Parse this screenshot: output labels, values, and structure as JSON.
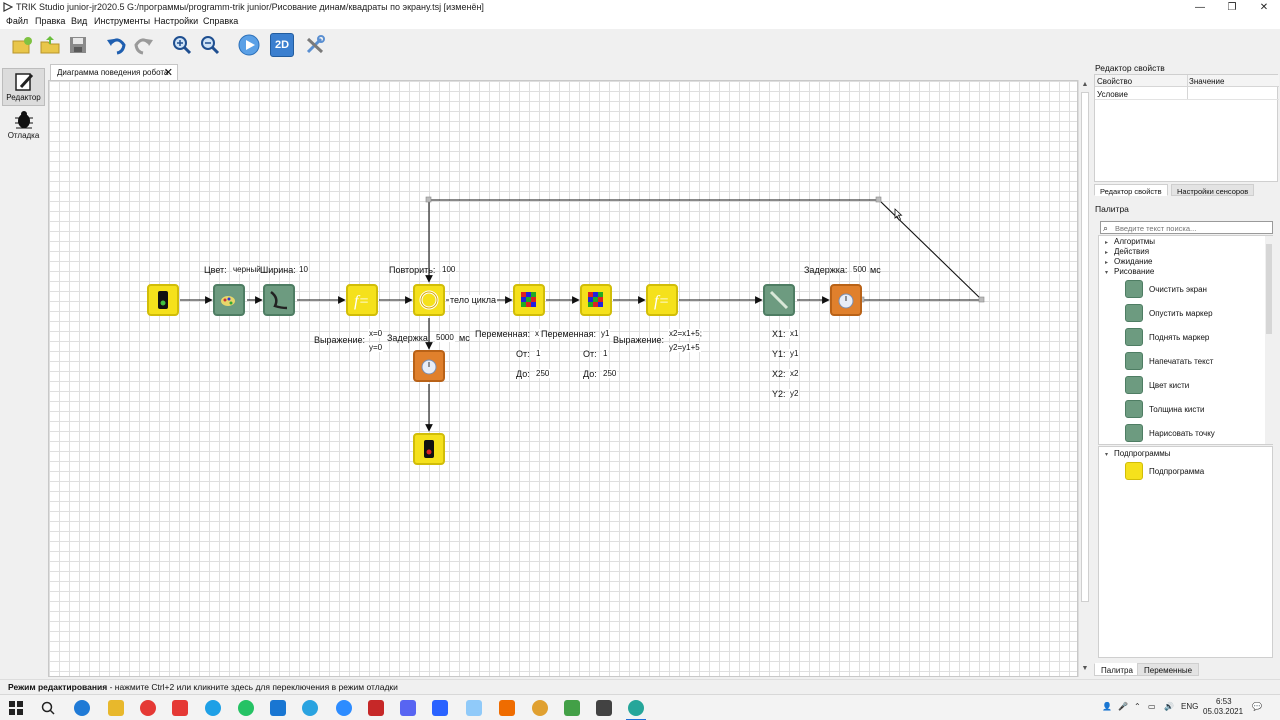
{
  "window": {
    "title": "TRIK Studio junior-jr2020.5 G:/программы/programm-trik junior/Рисование динам/квадраты по экрану.tsj [изменён]",
    "minimize": "—",
    "maximize": "❐",
    "close": "✕"
  },
  "menu": [
    "Файл",
    "Правка",
    "Вид",
    "Инструменты",
    "Настройки",
    "Справка"
  ],
  "toolbar": {
    "new": "new-file-icon",
    "open": "open-folder-icon",
    "save": "save-icon",
    "undo": "undo-icon",
    "redo": "redo-icon",
    "zoom_in": "zoom-in-icon",
    "zoom_out": "zoom-out-icon",
    "run": "run-icon",
    "twod_label": "2D",
    "settings": "tools-icon"
  },
  "modes": [
    {
      "label": "Редактор",
      "icon": "pencil-icon",
      "active": true
    },
    {
      "label": "Отладка",
      "icon": "bug-icon",
      "active": false
    }
  ],
  "tab": {
    "label": "Диаграмма поведения робота",
    "close": "✕"
  },
  "diagram": {
    "pen_color_label": "Цвет:",
    "pen_color_value": "черный",
    "pen_width_label": "Ширина:",
    "pen_width_value": "10",
    "repeat_label": "Повторить:",
    "repeat_value": "100",
    "loop_body_label": "тело цикла",
    "expr1_label": "Выражение:",
    "expr1_line1": "x=0",
    "expr1_line2": "y=0",
    "delay1_label": "Задержка:",
    "delay1_value": "5000",
    "delay1_unit": "мс",
    "var1_label": "Переменная:",
    "var1_value": "x",
    "from1_label": "От:",
    "from1_value": "1",
    "to1_label": "До:",
    "to1_value": "250",
    "var2_label": "Переменная:",
    "var2_value": "y1",
    "from2_label": "От:",
    "from2_value": "1",
    "to2_label": "До:",
    "to2_value": "250",
    "expr2_label": "Выражение:",
    "expr2_line1": "x2=x1+5;",
    "expr2_line2": "y2=y1+5",
    "line_x1_label": "X1:",
    "line_x1_value": "x1",
    "line_y1_label": "Y1:",
    "line_y1_value": "y1",
    "line_x2_label": "X2:",
    "line_x2_value": "x2",
    "line_y2_label": "Y2:",
    "line_y2_value": "y2",
    "delay2_label": "Задержка:",
    "delay2_value": "500",
    "delay2_unit": "мс"
  },
  "properties": {
    "title": "Редактор свойств",
    "col_property": "Свойство",
    "col_value": "Значение",
    "row_property": "Условие",
    "row_value": ""
  },
  "right_tabs": {
    "active": "Редактор свойств",
    "other": "Настройки сенсоров"
  },
  "palette": {
    "title": "Палитра",
    "search_placeholder": "Введите текст поиска...",
    "categories": [
      "Алгоритмы",
      "Действия",
      "Ожидание",
      "Рисование"
    ],
    "items": [
      "Очистить экран",
      "Опустить маркер",
      "Поднять маркер",
      "Напечатать текст",
      "Цвет кисти",
      "Толщина кисти",
      "Нарисовать точку"
    ],
    "sub_category": "Подпрограммы",
    "sub_item": "Подпрограмма"
  },
  "bottom_tabs": {
    "active": "Палитра",
    "other": "Переменные"
  },
  "status": {
    "mode": "Режим редактирования",
    "hint": " - нажмите Ctrl+2 или кликните здесь для переключения в режим отладки"
  },
  "taskbar": {
    "lang": "ENG",
    "time": "6:53",
    "date": "05.03.2021"
  }
}
